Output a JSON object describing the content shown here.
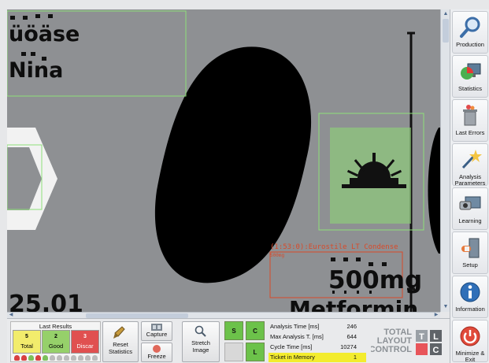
{
  "viewport": {
    "overlay_texts": {
      "text_top_1": "üöäse",
      "text_top_2": "Nina",
      "date_partial": "25.01",
      "word_partial": "Metformin",
      "font_label": "(1:53:0):Eurostile LT Condense",
      "ocr_label": "500mg",
      "ocr_small": "500mg"
    }
  },
  "sidebar": {
    "items": [
      {
        "label": "Production",
        "icon": "magnifier-icon"
      },
      {
        "label": "Statistics",
        "icon": "pie-chart-icon"
      },
      {
        "label": "Last Errors",
        "icon": "trash-icon"
      },
      {
        "label": "Analysis Parameters",
        "icon": "wand-icon"
      },
      {
        "label": "Learning",
        "icon": "camera-icon"
      },
      {
        "label": "Setup",
        "icon": "door-icon"
      },
      {
        "label": "Information",
        "icon": "info-icon"
      },
      {
        "label": "Minimize & Exit",
        "icon": "power-icon"
      }
    ]
  },
  "last_results": {
    "title": "Last Results",
    "total": {
      "count": "5",
      "label": "Total"
    },
    "good": {
      "count": "2",
      "label": "Good"
    },
    "discard": {
      "count": "3",
      "label": "Discar"
    },
    "history": [
      "bad",
      "bad",
      "good",
      "bad",
      "good",
      "none",
      "none",
      "none",
      "none",
      "none",
      "none",
      "none"
    ]
  },
  "toolbar": {
    "reset_label": "Reset Statistics",
    "capture_label": "Capture",
    "freeze_label": "Freeze",
    "stretch_label": "Stretch Image"
  },
  "sc_grid": {
    "cells": [
      {
        "label": "S",
        "state": "on"
      },
      {
        "label": "C",
        "state": "on"
      },
      {
        "label": "",
        "state": "off"
      },
      {
        "label": "L",
        "state": "on"
      }
    ]
  },
  "stats": [
    {
      "label": "Analysis Time [ms]",
      "value": "246",
      "highlight": false
    },
    {
      "label": "Max Analysis T. [ms]",
      "value": "644",
      "highlight": false
    },
    {
      "label": "Cycle Time [ms]",
      "value": "10274",
      "highlight": false
    },
    {
      "label": "Ticket in Memory",
      "value": "1",
      "highlight": true
    }
  ],
  "logo": {
    "line1": "TOTAL",
    "line2": "LAYOUT",
    "line3": "CONTROL",
    "letters": [
      "T",
      "L",
      "",
      "C"
    ]
  },
  "colors": {
    "roi_green": "#8fe07a",
    "roi_red": "#d84a2a",
    "tile_total": "#f2ec6c",
    "tile_good": "#96d06a",
    "tile_discard": "#e05050",
    "ticket_highlight": "#f3ec2e"
  }
}
